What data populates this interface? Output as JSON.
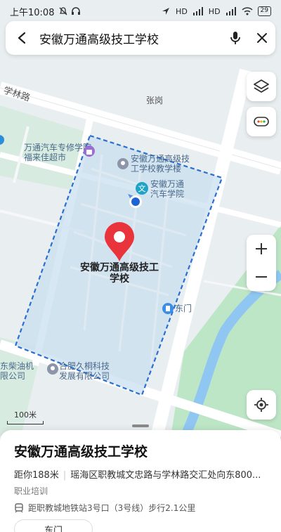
{
  "status_bar": {
    "time": "上午10:08",
    "signal_1": "HD",
    "signal_2": "HD",
    "battery": "29"
  },
  "search": {
    "query": "安徽万通高级技工学校"
  },
  "map": {
    "labels": {
      "road_xuelin": "学林路",
      "zhanggang": "张岗",
      "wantong_car": "万通汽车专修学院·福来佳超市",
      "teaching_building": "安徽万通高级技工学校教学楼",
      "wantong_auto_school": "安徽万通汽车学院",
      "marker_title": "安徽万通高级技工学校",
      "east_gate": "东门",
      "diesel_company": "东柴油机限公司",
      "jiu_tong": "合肥久桐科技发展有限公司"
    },
    "scale_label": "100米"
  },
  "sheet": {
    "title": "安徽万通高级技工学校",
    "distance": "距你188米",
    "address": "瑶海区职教城文忠路与学林路交汇处向东800...",
    "category": "职业培训",
    "transit": "距职教城地铁站3号口（3号线）步行2.1公里",
    "chip": "东门"
  },
  "colors": {
    "area_fill": "#c9dff0",
    "area_border": "#2a6fd1",
    "green": "#b7e4c2",
    "water": "#8fc7f2",
    "marker": "#e8343a"
  }
}
